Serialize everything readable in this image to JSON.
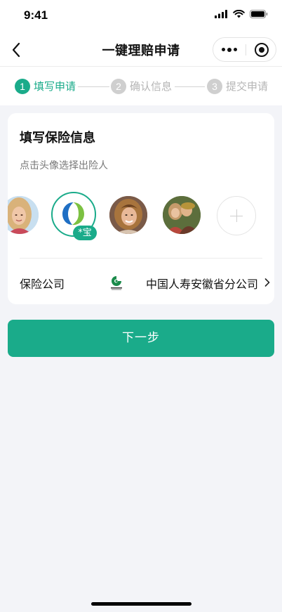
{
  "status_bar": {
    "time": "9:41"
  },
  "nav": {
    "title": "一键理赔申请"
  },
  "steps": [
    {
      "number": "1",
      "label": "填写申请",
      "state": "active"
    },
    {
      "number": "2",
      "label": "确认信息",
      "state": "pending"
    },
    {
      "number": "3",
      "label": "提交申请",
      "state": "pending"
    }
  ],
  "card": {
    "title": "填写保险信息",
    "hint": "点击头像选择出险人",
    "selected_badge": "*宝",
    "insurer_label": "保险公司",
    "insurer_value": "中国人寿安徽省分公司"
  },
  "actions": {
    "next_label": "下一步"
  },
  "colors": {
    "accent": "#1aab8a",
    "pending": "#cfcfcf",
    "background": "#f3f4f8"
  }
}
